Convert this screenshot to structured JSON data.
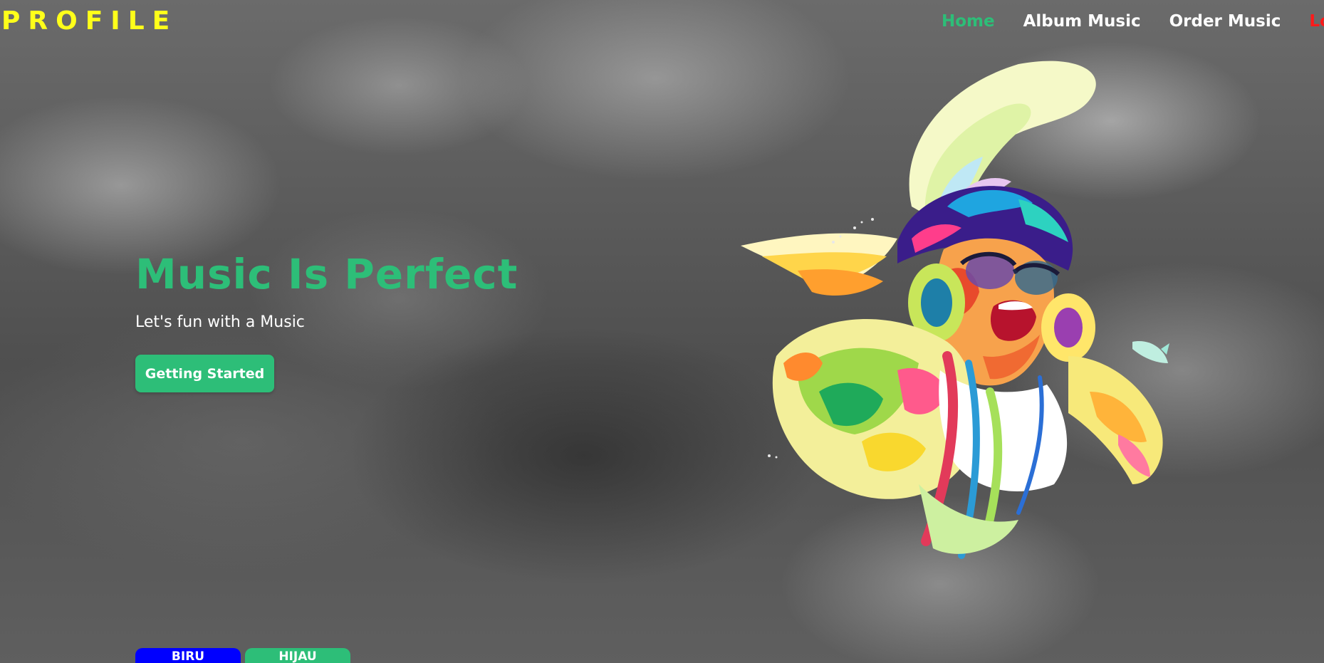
{
  "brand": {
    "title": "PROFILE"
  },
  "nav": {
    "home": "Home",
    "album": "Album Music",
    "order": "Order Music",
    "logout": "Logout"
  },
  "hero": {
    "title": "Music Is Perfect",
    "subtitle": "Let's fun with a Music",
    "cta": "Getting Started"
  },
  "theme": {
    "blue_label": "BIRU",
    "green_label": "HIJAU"
  },
  "colors": {
    "accent_green": "#2dbe78",
    "brand_yellow": "#ffff1a",
    "logout_red": "#ff1a1a",
    "blue": "#0000ff"
  }
}
